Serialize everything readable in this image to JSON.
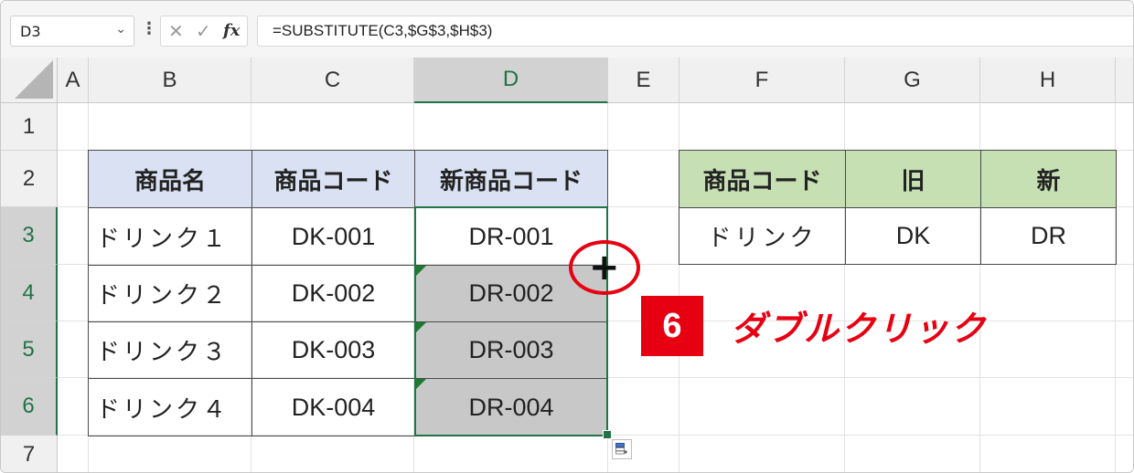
{
  "formula_bar": {
    "name_box": "D3",
    "name_box_arrow": "⌄",
    "menu_dots": "⋮",
    "cancel_icon": "✕",
    "enter_icon": "✓",
    "fx_label": "fx",
    "formula": "=SUBSTITUTE(C3,$G$3,$H$3)"
  },
  "columns": [
    "A",
    "B",
    "C",
    "D",
    "E",
    "F",
    "G",
    "H"
  ],
  "rows": [
    "1",
    "2",
    "3",
    "4",
    "5",
    "6",
    "7"
  ],
  "selected": {
    "column": "D",
    "rows": [
      "3",
      "4",
      "5",
      "6"
    ]
  },
  "table1": {
    "headers": [
      "商品名",
      "商品コード",
      "新商品コード"
    ],
    "rows": [
      [
        "ドリンク１",
        "DK-001",
        "DR-001"
      ],
      [
        "ドリンク２",
        "DK-002",
        "DR-002"
      ],
      [
        "ドリンク３",
        "DK-003",
        "DR-003"
      ],
      [
        "ドリンク４",
        "DK-004",
        "DR-004"
      ]
    ]
  },
  "table2": {
    "headers": [
      "商品コード",
      "旧",
      "新"
    ],
    "row": [
      "ドリンク",
      "DK",
      "DR"
    ]
  },
  "annotation": {
    "plus": "+",
    "step_number": "6",
    "label": "ダブルクリック",
    "color": "#e60012"
  },
  "colors": {
    "header_blue": "#d9e1f2",
    "header_green": "#c6e0b4",
    "selection_green": "#217346"
  }
}
